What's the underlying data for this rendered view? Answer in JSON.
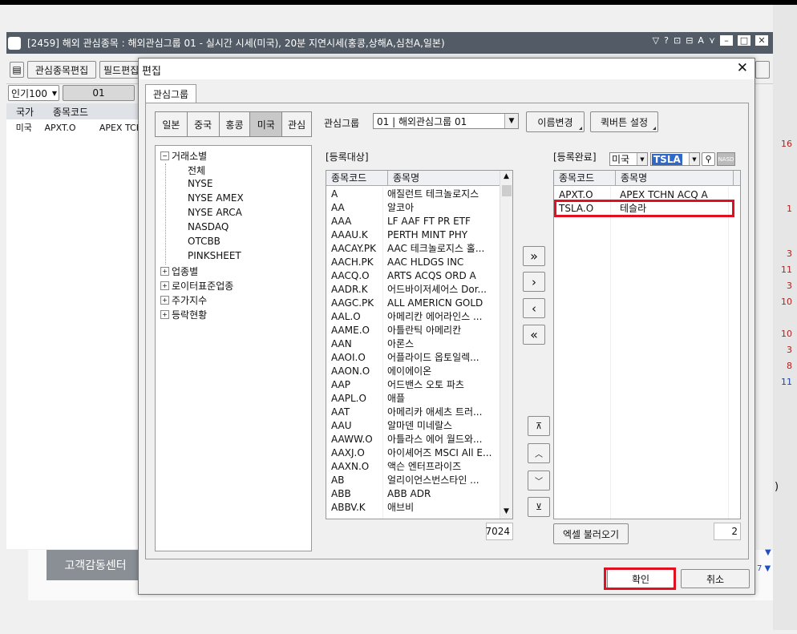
{
  "background_app": {
    "title": "[2459] 해외 관심종목 : 해외관심그룹 01 - 실시간 시세(미국), 20분 지연시세(홍콩,상해A,심천A,일본)",
    "toolbar": {
      "edit_watchlist": "관심종목편집",
      "field_edit": "필드편집"
    },
    "group_select": "인기100",
    "group_tab": "01",
    "table_headers": [
      "국가",
      "종목코드"
    ],
    "rows": [
      {
        "country": "미국",
        "code": "APXT.O",
        "name": "APEX TCH"
      }
    ],
    "right_numbers": [
      "16",
      "1",
      "3",
      "11",
      "3",
      "10",
      "10",
      "3",
      "8",
      "11"
    ],
    "customer_center": "고객감동센터",
    "right_marks": [
      ")",
      "▼",
      "7 ▼"
    ]
  },
  "dialog": {
    "title": "편집",
    "tab": "관심그룹",
    "country_tabs": [
      "일본",
      "중국",
      "홍콩",
      "미국",
      "관심"
    ],
    "active_country": "미국",
    "tree": {
      "root": "거래소별",
      "children": [
        "전체",
        "NYSE",
        "NYSE AMEX",
        "NYSE ARCA",
        "NASDAQ",
        "OTCBB",
        "PINKSHEET"
      ],
      "others": [
        "업종별",
        "로이터표준업종",
        "주가지수",
        "등락현황"
      ]
    },
    "group_label": "관심그룹",
    "group_value": "01 | 해외관심그룹 01",
    "rename_button": "이름변경",
    "quick_button": "퀵버튼 설정",
    "register_target_label": "[등록대상]",
    "register_done_label": "[등록완료]",
    "right_country": "미국",
    "search_value": "TSLA",
    "nasd_badge": "NASD",
    "left_headers": [
      "종목코드",
      "종목명"
    ],
    "left_rows": [
      {
        "code": "A",
        "name": "애질런트 테크놀로지스"
      },
      {
        "code": "AA",
        "name": "알코아"
      },
      {
        "code": "AAA",
        "name": "LF AAF FT PR ETF"
      },
      {
        "code": "AAAU.K",
        "name": "PERTH MINT PHY"
      },
      {
        "code": "AACAY.PK",
        "name": "AAC 테크놀로지스 홀..."
      },
      {
        "code": "AACH.PK",
        "name": "AAC HLDGS INC"
      },
      {
        "code": "AACQ.O",
        "name": "ARTS ACQS ORD A"
      },
      {
        "code": "AADR.K",
        "name": "어드바이저셰어스 Dor..."
      },
      {
        "code": "AAGC.PK",
        "name": "ALL AMERICN GOLD"
      },
      {
        "code": "AAL.O",
        "name": "아메리칸 에어라인스 ..."
      },
      {
        "code": "AAME.O",
        "name": "아틀란틱 아메리칸"
      },
      {
        "code": "AAN",
        "name": "아론스"
      },
      {
        "code": "AAOI.O",
        "name": "어플라이드 옵토일렉..."
      },
      {
        "code": "AAON.O",
        "name": "에이에이온"
      },
      {
        "code": "AAP",
        "name": "어드밴스 오토 파츠"
      },
      {
        "code": "AAPL.O",
        "name": "애플"
      },
      {
        "code": "AAT",
        "name": "아메리카 애세츠 트러..."
      },
      {
        "code": "AAU",
        "name": "알마덴 미네랄스"
      },
      {
        "code": "AAWW.O",
        "name": "아틀라스 에어 월드와..."
      },
      {
        "code": "AAXJ.O",
        "name": "아이셰어즈 MSCI All E..."
      },
      {
        "code": "AAXN.O",
        "name": "액슨 엔터프라이즈"
      },
      {
        "code": "AB",
        "name": "얼리이언스번스타인 ..."
      },
      {
        "code": "ABB",
        "name": "ABB ADR"
      },
      {
        "code": "ABBV.K",
        "name": "애브비"
      }
    ],
    "left_count": "7024",
    "right_headers": [
      "종목코드",
      "종목명"
    ],
    "right_rows": [
      {
        "code": "APXT.O",
        "name": "APEX TCHN ACQ A"
      },
      {
        "code": "TSLA.O",
        "name": "테슬라"
      }
    ],
    "right_count": "2",
    "excel_button": "엑셀 불러오기",
    "ok_button": "확인",
    "cancel_button": "취소",
    "highlight_color": "#e01020"
  }
}
